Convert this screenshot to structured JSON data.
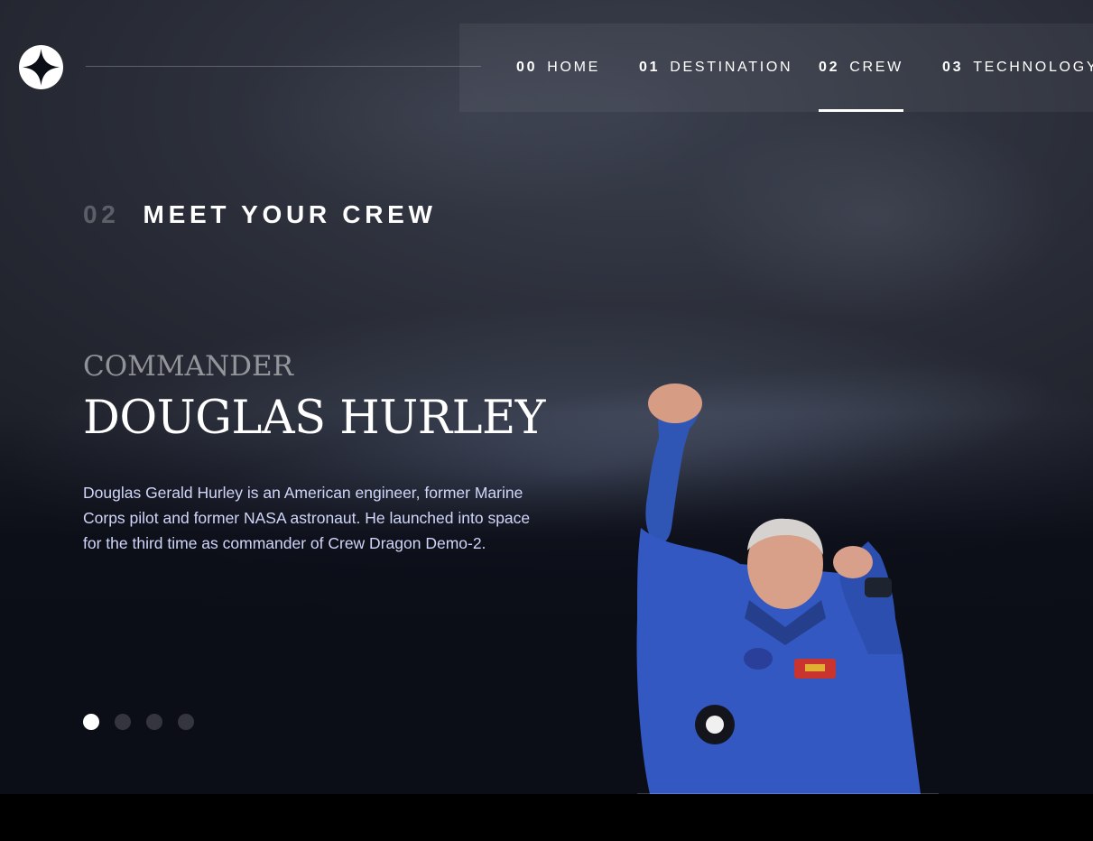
{
  "colors": {
    "background": "#0b0d17",
    "accent_text": "#d0d6f9",
    "white": "#ffffff"
  },
  "logo": {
    "icon": "star-logo-icon"
  },
  "nav": {
    "items": [
      {
        "num": "00",
        "label": "HOME",
        "active": false
      },
      {
        "num": "01",
        "label": "DESTINATION",
        "active": false
      },
      {
        "num": "02",
        "label": "CREW",
        "active": true
      },
      {
        "num": "03",
        "label": "TECHNOLOGY",
        "active": false
      }
    ]
  },
  "page": {
    "heading_num": "02",
    "heading": "MEET YOUR CREW"
  },
  "crew": {
    "role": "COMMANDER",
    "name": "DOUGLAS HURLEY",
    "bio": "Douglas Gerald Hurley is an American engineer, former Marine Corps pilot and former NASA astronaut. He launched into space for the third time as commander of Crew Dragon Demo-2.",
    "image": "crew-member-portrait",
    "slides": {
      "count": 4,
      "active_index": 0
    }
  }
}
